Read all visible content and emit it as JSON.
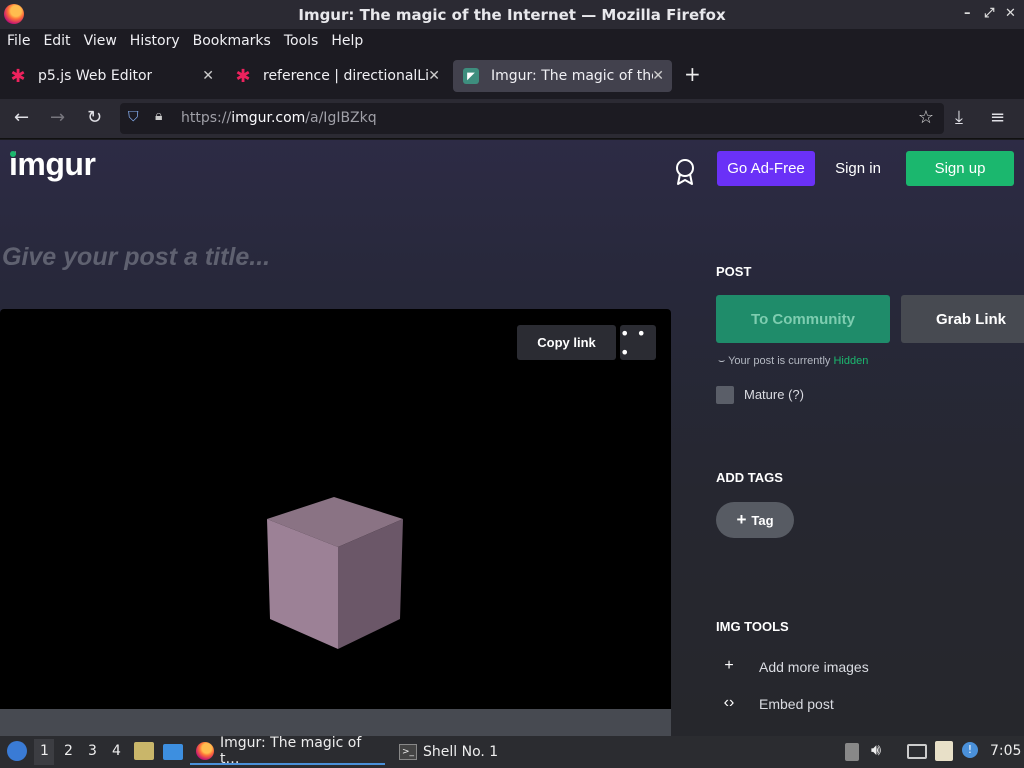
{
  "window": {
    "title": "Imgur: The magic of the Internet — Mozilla Firefox",
    "controls": [
      "–",
      "⤢",
      "✕"
    ]
  },
  "menu": [
    "File",
    "Edit",
    "View",
    "History",
    "Bookmarks",
    "Tools",
    "Help"
  ],
  "tabs": [
    {
      "label": "p5.js Web Editor",
      "icon": "p5-asterisk-icon",
      "active": false
    },
    {
      "label": "reference | directionalLig",
      "icon": "p5-asterisk-icon",
      "active": false
    },
    {
      "label": "Imgur: The magic of the",
      "icon": "imgur-favicon",
      "active": true
    }
  ],
  "nav": {
    "url_prefix": "https://",
    "url_host": "imgur.com",
    "url_path": "/a/IgIBZkq"
  },
  "header": {
    "logo": "imgur",
    "ad_free": "Go Ad-Free",
    "sign_in": "Sign in",
    "sign_up": "Sign up"
  },
  "post": {
    "title_placeholder": "Give your post a title...",
    "copy_link": "Copy link",
    "more": "• • •"
  },
  "sidebar": {
    "post_heading": "POST",
    "to_community": "To Community",
    "grab_link": "Grab Link",
    "hidden_prefix": "Your post is currently",
    "hidden_word": "Hidden",
    "mature_label": "Mature (?)",
    "tags_heading": "ADD TAGS",
    "tag_button": "Tag",
    "tools_heading": "IMG TOOLS",
    "tools": [
      {
        "icon": "plus-icon",
        "label": "Add more images"
      },
      {
        "icon": "code-icon",
        "label": "Embed post"
      }
    ]
  },
  "taskbar": {
    "workspaces": [
      "1",
      "2",
      "3",
      "4"
    ],
    "apps": [
      {
        "label": "Imgur: The magic of t…",
        "icon": "firefox-icon"
      },
      {
        "label": "Shell No. 1",
        "icon": "terminal-icon"
      }
    ],
    "clock": "7:05"
  },
  "colors": {
    "accent_purple": "#6a31f7",
    "accent_green": "#1bb76e",
    "community_green": "#1f8c6a"
  }
}
